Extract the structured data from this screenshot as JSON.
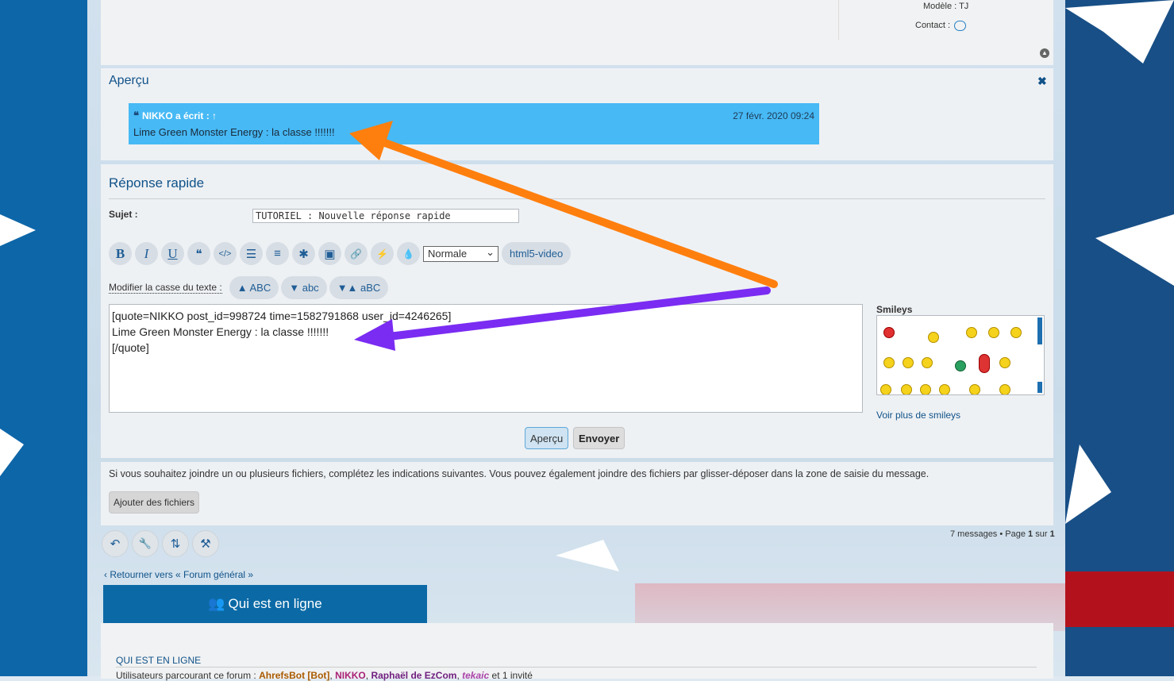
{
  "profile": {
    "model_label": "Modèle :",
    "model_value": "TJ",
    "contact_label": "Contact :"
  },
  "preview": {
    "title": "Aperçu",
    "close_icon": "✖",
    "quote_author": "NIKKO a écrit :",
    "quote_arrow": "↑",
    "quote_date": "27 févr. 2020 09:24",
    "quote_text": "Lime Green Monster Energy : la classe !!!!!!!"
  },
  "reply": {
    "title": "Réponse rapide",
    "subject_label": "Sujet :",
    "subject_value": "TUTORIEL : Nouvelle réponse rapide",
    "toolbar": {
      "bold": "B",
      "italic": "I",
      "underline": "U",
      "quote": "❝",
      "code": "</>",
      "list": "☰",
      "list_ordered": "≡",
      "list_item": "✱",
      "image": "▣",
      "link": "🔗",
      "flash": "⚡",
      "color": "💧",
      "font_size": "Normale",
      "html5_video": "html5-video"
    },
    "case_label": "Modifier la casse du texte :",
    "case_upper": "▲ ABC",
    "case_lower": "▼ abc",
    "case_toggle": "▼▲ aBC",
    "message": "[quote=NIKKO post_id=998724 time=1582791868 user_id=4246265]\nLime Green Monster Energy : la classe !!!!!!!\n[/quote]",
    "smileys_title": "Smileys",
    "more_smileys": "Voir plus de smileys",
    "preview_button": "Aperçu",
    "send_button": "Envoyer"
  },
  "attach": {
    "text": "Si vous souhaitez joindre un ou plusieurs fichiers, complétez les indications suivantes. Vous pouvez également joindre des fichiers par glisser-déposer dans la zone de saisie du message.",
    "button": "Ajouter des fichiers"
  },
  "actions": {
    "reply_icon": "↶",
    "tools_icon": "🔧",
    "sort_icon": "⇅",
    "moderate_icon": "⚒"
  },
  "pagination": {
    "prefix": "7 messages • Page",
    "current": "1",
    "sep": "sur",
    "total": "1"
  },
  "back_link": "Retourner vers « Forum général »",
  "online": {
    "header": "Qui est en ligne",
    "title": "QUI EST EN LIGNE",
    "users_prefix": "Utilisateurs parcourant ce forum :",
    "user1": "AhrefsBot [Bot]",
    "user2": "NIKKO",
    "user3": "Raphaël de EzCom",
    "user4": "tekaic",
    "suffix": "et 1 invité"
  },
  "colors": {
    "quote_bg": "#47b9f5",
    "link": "#105289",
    "arrow_orange": "#ff7f0e",
    "arrow_purple": "#7a2cf2"
  }
}
